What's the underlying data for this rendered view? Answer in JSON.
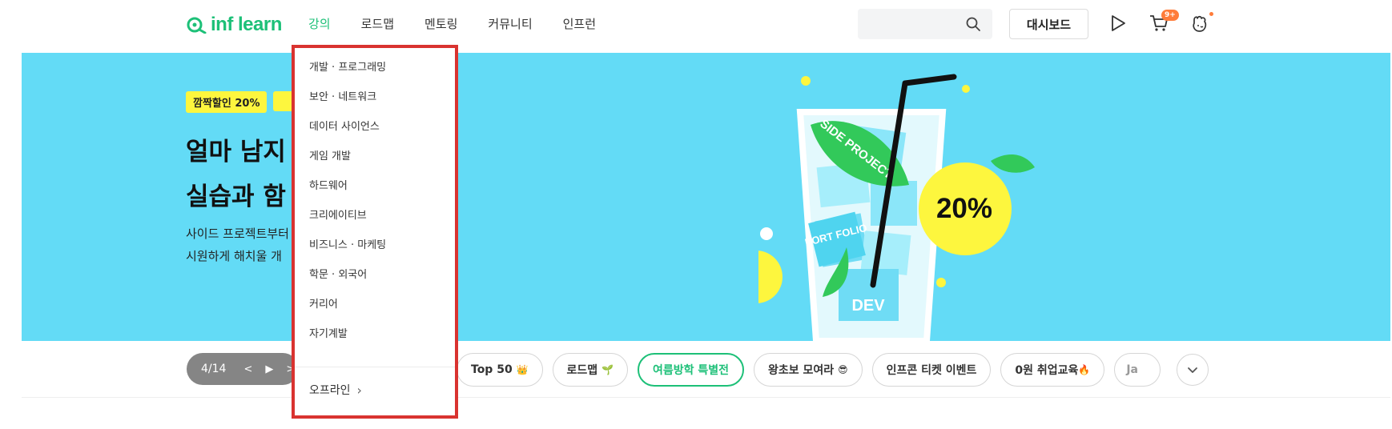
{
  "header": {
    "logo_text": "inf learn",
    "nav": [
      {
        "label": "강의",
        "active": true
      },
      {
        "label": "로드맵",
        "active": false
      },
      {
        "label": "멘토링",
        "active": false
      },
      {
        "label": "커뮤니티",
        "active": false
      },
      {
        "label": "인프런",
        "active": false
      }
    ],
    "search_placeholder": "",
    "dashboard_label": "대시보드",
    "cart_badge": "9+"
  },
  "banner": {
    "badges": [
      "깜짝할인 20%",
      ""
    ],
    "headline_line1": "얼마 남지",
    "headline_line2": "실습과 함",
    "subline_line1": "사이드 프로젝트부터",
    "subline_line2": "시원하게 해치울 개",
    "art": {
      "sticker_side_project": "SIDE PROJECT",
      "sticker_portfolio": "PORT FOLIO",
      "sticker_dev": "DEV",
      "discount": "20%"
    },
    "comma": ","
  },
  "slider": {
    "count": "4/14",
    "prev": "<",
    "play": "▶",
    "next": ">"
  },
  "chips": [
    {
      "label": "Top 50",
      "emoji": "👑",
      "style": "normal"
    },
    {
      "label": "로드맵",
      "emoji": "🌱",
      "style": "normal"
    },
    {
      "label": "여름방학 특별전",
      "emoji": "",
      "style": "green"
    },
    {
      "label": "왕초보 모여라",
      "emoji": "😎",
      "style": "normal"
    },
    {
      "label": "인프콘 티켓 이벤트",
      "emoji": "",
      "style": "normal"
    },
    {
      "label": "0원 취업교육",
      "emoji": "🔥",
      "style": "normal"
    },
    {
      "label": "Ja",
      "emoji": "",
      "style": "cut"
    }
  ],
  "dropdown": {
    "items": [
      "개발 · 프로그래밍",
      "보안 · 네트워크",
      "데이터 사이언스",
      "게임 개발",
      "하드웨어",
      "크리에이티브",
      "비즈니스 · 마케팅",
      "학문 · 외국어",
      "커리어",
      "자기계발"
    ],
    "offline_label": "오프라인",
    "offline_arrow": "›"
  },
  "colors": {
    "brand_green": "#1dc078",
    "banner_bg": "#63dbf6",
    "highlight_border": "#d93330",
    "badge_yellow": "#fdf63e",
    "cart_badge_bg": "#ff7c3a"
  },
  "icons": [
    "search-icon",
    "play-icon",
    "cart-icon",
    "notification-icon",
    "chevron-down-icon",
    "chevron-right-icon"
  ]
}
